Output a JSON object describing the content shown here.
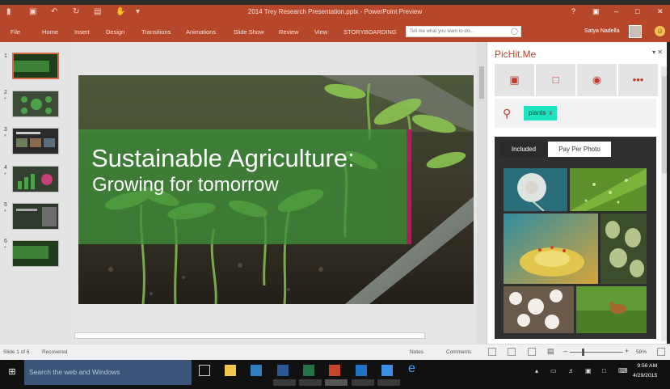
{
  "window": {
    "title": "2014 Trey Research Presentation.pptx - PowerPoint Preview",
    "controls": [
      "?",
      "▣",
      "–",
      "□",
      "✕"
    ]
  },
  "ribbon": {
    "tabs": [
      "File",
      "Home",
      "Insert",
      "Design",
      "Transitions",
      "Animations",
      "Slide Show",
      "Review",
      "View",
      "STORYBOARDING"
    ],
    "tell_me_placeholder": "Tell me what you want to do...",
    "user_name": "Satya Nadella"
  },
  "thumbnails": [
    {
      "num": "1",
      "selected": true
    },
    {
      "num": "2",
      "selected": false
    },
    {
      "num": "3",
      "selected": false
    },
    {
      "num": "4",
      "selected": false
    },
    {
      "num": "5",
      "selected": false
    },
    {
      "num": "6",
      "selected": false
    }
  ],
  "slide": {
    "title": "Sustainable Agriculture:",
    "subtitle": "Growing for tomorrow"
  },
  "pichit": {
    "title": "PicHit.Me",
    "pane_controls": "▾ ✕",
    "toolbar_icons": [
      "image-icon",
      "folder-icon",
      "camera-add-icon",
      "more-icon"
    ],
    "search_tag": "plants",
    "search_tag_remove": "x",
    "tabs": [
      "Included",
      "Pay Per Photo"
    ]
  },
  "status": {
    "slide_info": "Slide 1 of 6",
    "recovered": "Recovered",
    "notes": "Notes",
    "comments": "Comments",
    "zoom": "58%"
  },
  "taskbar": {
    "search_placeholder": "Search the web and Windows",
    "time": "9:56 AM",
    "date": "4/29/2015"
  },
  "colors": {
    "accent": "#b7472a",
    "chip": "#1ee3c0",
    "slide_band": "#3f8f3a",
    "slide_stripe": "#a3245a"
  }
}
